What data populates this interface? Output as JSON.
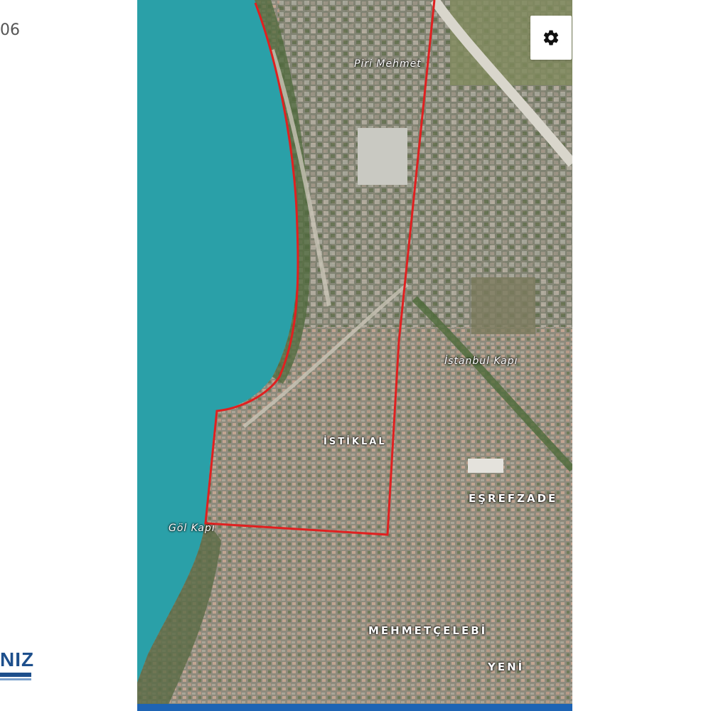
{
  "page": {
    "left_edge_text": "06",
    "logo_text": "NIZ"
  },
  "map": {
    "colors": {
      "lake": "#2aa0a8",
      "urban": "#8c8a7c",
      "boundary": "#e02020",
      "bottom_strip": "#1e64b4"
    },
    "labels": {
      "piri_mehmet": "Piri Mehmet",
      "istanbul_kapi": "İstanbul Kapı",
      "istiklal": "İSTİKLAL",
      "esrefzade": "EŞREFZADE",
      "gol_kapi": "Göl Kapı",
      "mehmetcelebi": "MEHMETÇELEBİ",
      "yeni": "YENİ"
    },
    "controls": {
      "settings_icon": "gear-icon"
    }
  }
}
